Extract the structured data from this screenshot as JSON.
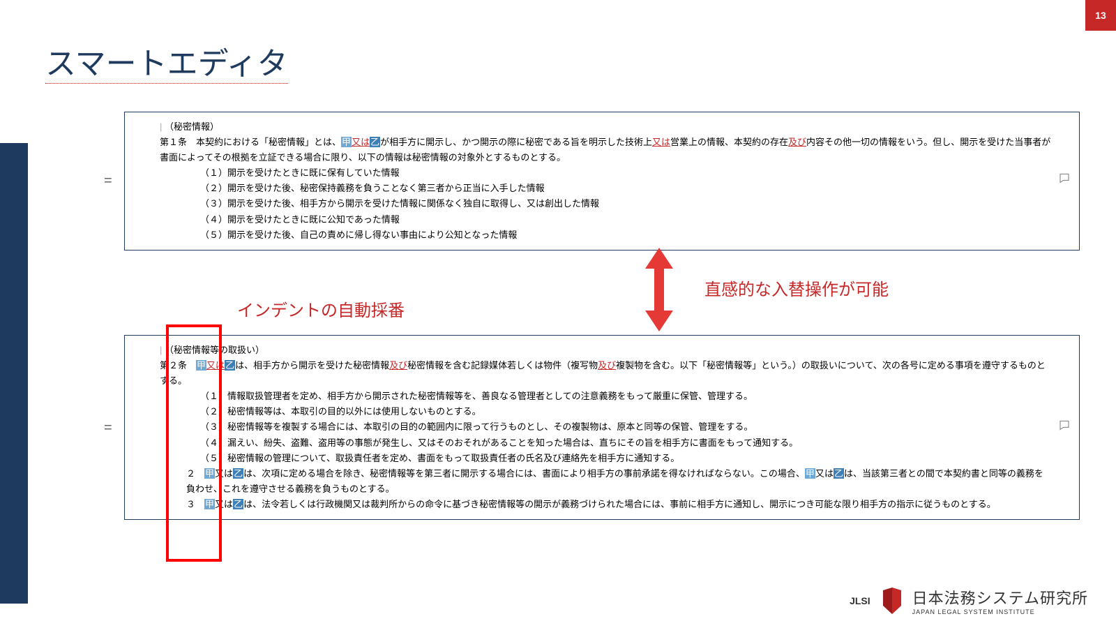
{
  "page_number": "13",
  "title": "スマートエディタ",
  "callouts": {
    "indent": "インデントの自動採番",
    "swap": "直感的な入替操作が可能"
  },
  "clause1": {
    "heading": "（秘密情報）",
    "art_label": "第１条",
    "intro_a": "本契約における「秘密情報」とは、",
    "ko": "甲",
    "mata": "又は",
    "otsu": "乙",
    "intro_b": "が相手方に開示し、かつ開示の際に秘密である旨を明示した技術上",
    "intro_c": "営業上の情報、本契約の存在",
    "oyobi": "及び",
    "intro_d": "内容その他一切の情報をいう。但し、開示を受けた当事者が書面によってその根拠を立証できる場合に限り、以下の情報は秘密情報の対象外とするものとする。",
    "items": [
      "（１）開示を受けたときに既に保有していた情報",
      "（２）開示を受けた後、秘密保持義務を負うことなく第三者から正当に入手した情報",
      "（３）開示を受けた後、相手方から開示を受けた情報に関係なく独自に取得し、又は創出した情報",
      "（４）開示を受けたときに既に公知であった情報",
      "（５）開示を受けた後、自己の責めに帰し得ない事由により公知となった情報"
    ]
  },
  "clause2": {
    "heading": "（秘密情報等の取扱い）",
    "art_label": "第２条",
    "intro_a": "は、相手方から開示を受けた秘密情報",
    "intro_b": "秘密情報を含む記録媒体若しくは物件（複写物",
    "intro_c": "複製物を含む。以下「秘密情報等」という。）の取扱いについて、次の各号に定める事項を遵守するものとする。",
    "items": [
      "（１）情報取扱管理者を定め、相手方から開示された秘密情報等を、善良なる管理者としての注意義務をもって厳重に保管、管理する。",
      "（２）秘密情報等は、本取引の目的以外には使用しないものとする。",
      "（３）秘密情報等を複製する場合には、本取引の目的の範囲内に限って行うものとし、その複製物は、原本と同等の保管、管理をする。",
      "（４）漏えい、紛失、盗難、盗用等の事態が発生し、又はそのおそれがあることを知った場合は、直ちにその旨を相手方に書面をもって通知する。",
      "（５）秘密情報の管理について、取扱責任者を定め、書面をもって取扱責任者の氏名及び連絡先を相手方に通知する。"
    ],
    "sub2_label": "２",
    "sub2_a": "は、次項に定める場合を除き、秘密情報等を第三者に開示する場合には、書面により相手方の事前承諾を得なければならない。この場合、",
    "sub2_b": "は、当該第三者との間で本契約書と同等の義務を負わせ、これを遵守させる義務を負うものとする。",
    "sub3_label": "３",
    "sub3_a": "は、法令若しくは行政機関又は裁判所からの命令に基づき秘密情報等の開示が義務づけられた場合には、事前に相手方に通知し、開示につき可能な限り相手方の指示に従うものとする。"
  },
  "footer": {
    "jlsi": "JLSI",
    "main": "日本法務システム研究所",
    "sub": "JAPAN LEGAL SYSTEM INSTITUTE"
  }
}
